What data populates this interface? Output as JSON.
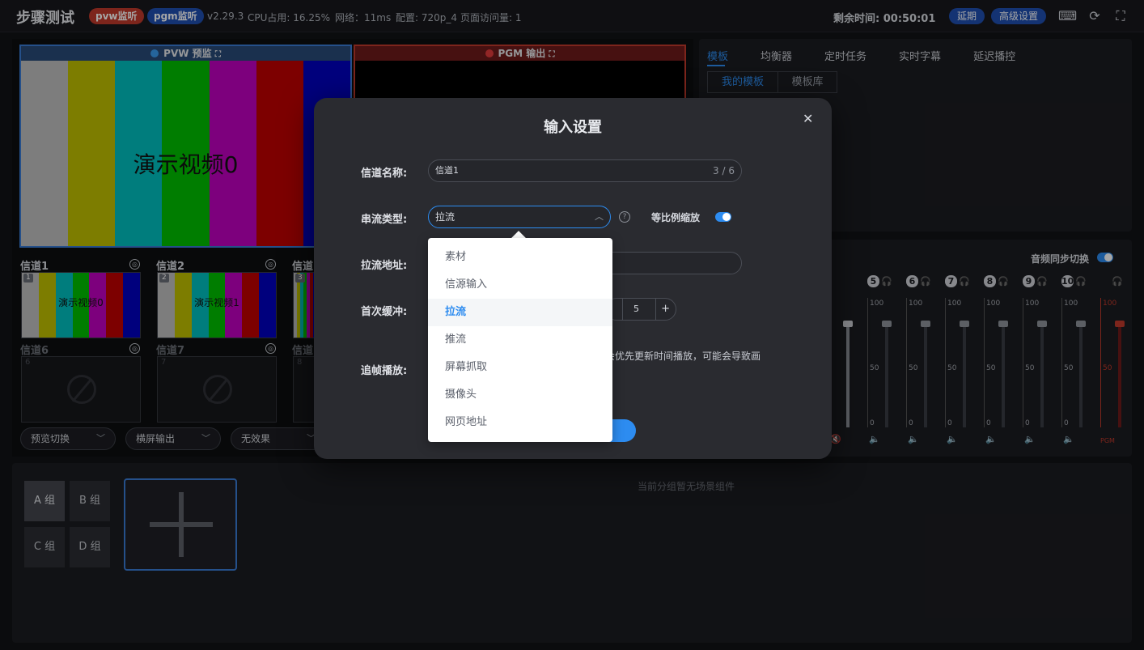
{
  "header": {
    "title": "步骤测试",
    "pvw_badge": "pvw监听",
    "pgm_badge": "pgm监听",
    "version": "v2.29.3",
    "cpu": "CPU占用: 16.25%",
    "network": "网络：11ms",
    "config": "配置: 720p_4",
    "visits": "页面访问量: 1",
    "remaining": "剩余时间: 00:50:01",
    "extend_btn": "延期",
    "advanced_btn": "高级设置"
  },
  "preview": {
    "pvw_label": "PVW 预监",
    "pgm_label": "PGM 输出",
    "overlay_text": "演示视频0"
  },
  "channels": [
    {
      "name": "信道1",
      "num": "1",
      "text": "演示视频0"
    },
    {
      "name": "信道2",
      "num": "2",
      "text": "演示视频1"
    },
    {
      "name": "信道",
      "num": "3",
      "text": ""
    },
    {
      "name": "信道6",
      "num": "6"
    },
    {
      "name": "信道7",
      "num": "7"
    },
    {
      "name": "信道",
      "num": "8"
    }
  ],
  "bottom_selects": [
    "预览切换",
    "横屏输出",
    "无效果"
  ],
  "right_tabs": [
    "模板",
    "均衡器",
    "定时任务",
    "实时字幕",
    "延迟播控"
  ],
  "sub_tabs": [
    "我的模板",
    "模板库"
  ],
  "mixer": {
    "sync_label": "音频同步切换",
    "channels": [
      "5",
      "6",
      "7",
      "8",
      "9",
      "10"
    ],
    "pgm_label": "PGM",
    "scale_top": "100",
    "scale_mid": "50",
    "scale_low": "0"
  },
  "scene": {
    "groups": [
      "A 组",
      "B 组",
      "C 组",
      "D 组"
    ],
    "empty_text": "当前分组暂无场景组件"
  },
  "modal": {
    "title": "输入设置",
    "name_label": "信道名称:",
    "name_value": "信道1",
    "name_count": "3 / 6",
    "type_label": "串流类型:",
    "type_value": "拉流",
    "ratio_label": "等比例缩放",
    "url_label": "拉流地址:",
    "buffer_label": "首次缓冲:",
    "buffer_value": "5",
    "chase_label": "追帧播放:",
    "chase_desc": "会优先更新时间播放，可能会导致画",
    "help_icon": "?"
  },
  "dropdown_options": [
    "素材",
    "信源输入",
    "拉流",
    "推流",
    "屏幕抓取",
    "摄像头",
    "网页地址"
  ],
  "colors": {
    "accent": "#2d8cf0",
    "pvw_border": "#3a7bd5",
    "pgm_border": "#c0392b",
    "bars": [
      "#c0c0c0",
      "#c0c000",
      "#00c0c0",
      "#00c000",
      "#c000c0",
      "#c00000",
      "#0000c0"
    ]
  }
}
